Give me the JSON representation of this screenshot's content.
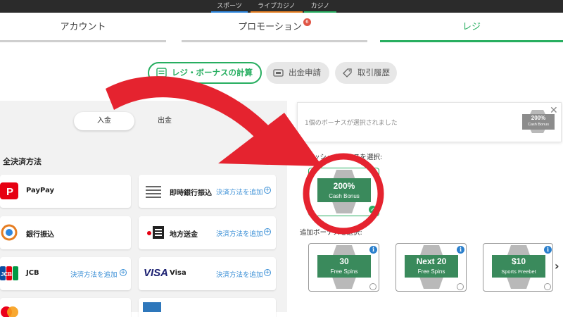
{
  "topnav": {
    "items": [
      {
        "label": "スポーツ",
        "color": "#2e86de"
      },
      {
        "label": "ライブカジノ",
        "color": "#e67e22"
      },
      {
        "label": "カジノ",
        "color": "#27ae60"
      }
    ]
  },
  "tabs": {
    "account": "アカウント",
    "promotion": "プロモーション",
    "promotion_badge": "6",
    "cashier": "レジ"
  },
  "subtabs": {
    "calc": "レジ・ボーナスの計算",
    "withdraw": "出金申請",
    "history": "取引履歴"
  },
  "toggle": {
    "deposit": "入金",
    "withdraw": "出金"
  },
  "payment": {
    "section_title": "全決済方法",
    "add_label": "決済方法を追加",
    "methods": [
      {
        "name": "PayPay",
        "icon": "paypay-logo"
      },
      {
        "name": "即時銀行振込",
        "icon": "bank-lines-icon"
      },
      {
        "name": "銀行振込",
        "icon": "bank-transfer-icon"
      },
      {
        "name": "地方送金",
        "icon": "local-remit-icon"
      },
      {
        "name": "JCB",
        "icon": "jcb-logo"
      },
      {
        "name": "Visa",
        "logo_text": "VISA",
        "icon": "visa-logo"
      }
    ],
    "jcb_logo_text": "JCB"
  },
  "bonus": {
    "selected_text": "1個のボーナスが選択されました",
    "selected_badge_line1": "200%",
    "selected_badge_line2": "Cash Bonus",
    "cash_heading": "キャッシュボーナスを選択:",
    "cash_card_line1": "200%",
    "cash_card_line2": "Cash Bonus",
    "extra_heading": "追加ボーナスを選択:",
    "extra_cards": [
      {
        "line1": "30",
        "line2": "Free Spins"
      },
      {
        "line1": "Next 20",
        "line2": "Free Spins"
      },
      {
        "line1": "$10",
        "line2": "Sports Freebet"
      }
    ]
  },
  "colors": {
    "accent_green": "#27ae60",
    "bonus_green": "#3a8a5c",
    "annotation_red": "#e5232f",
    "link_blue": "#3a8fd6"
  }
}
